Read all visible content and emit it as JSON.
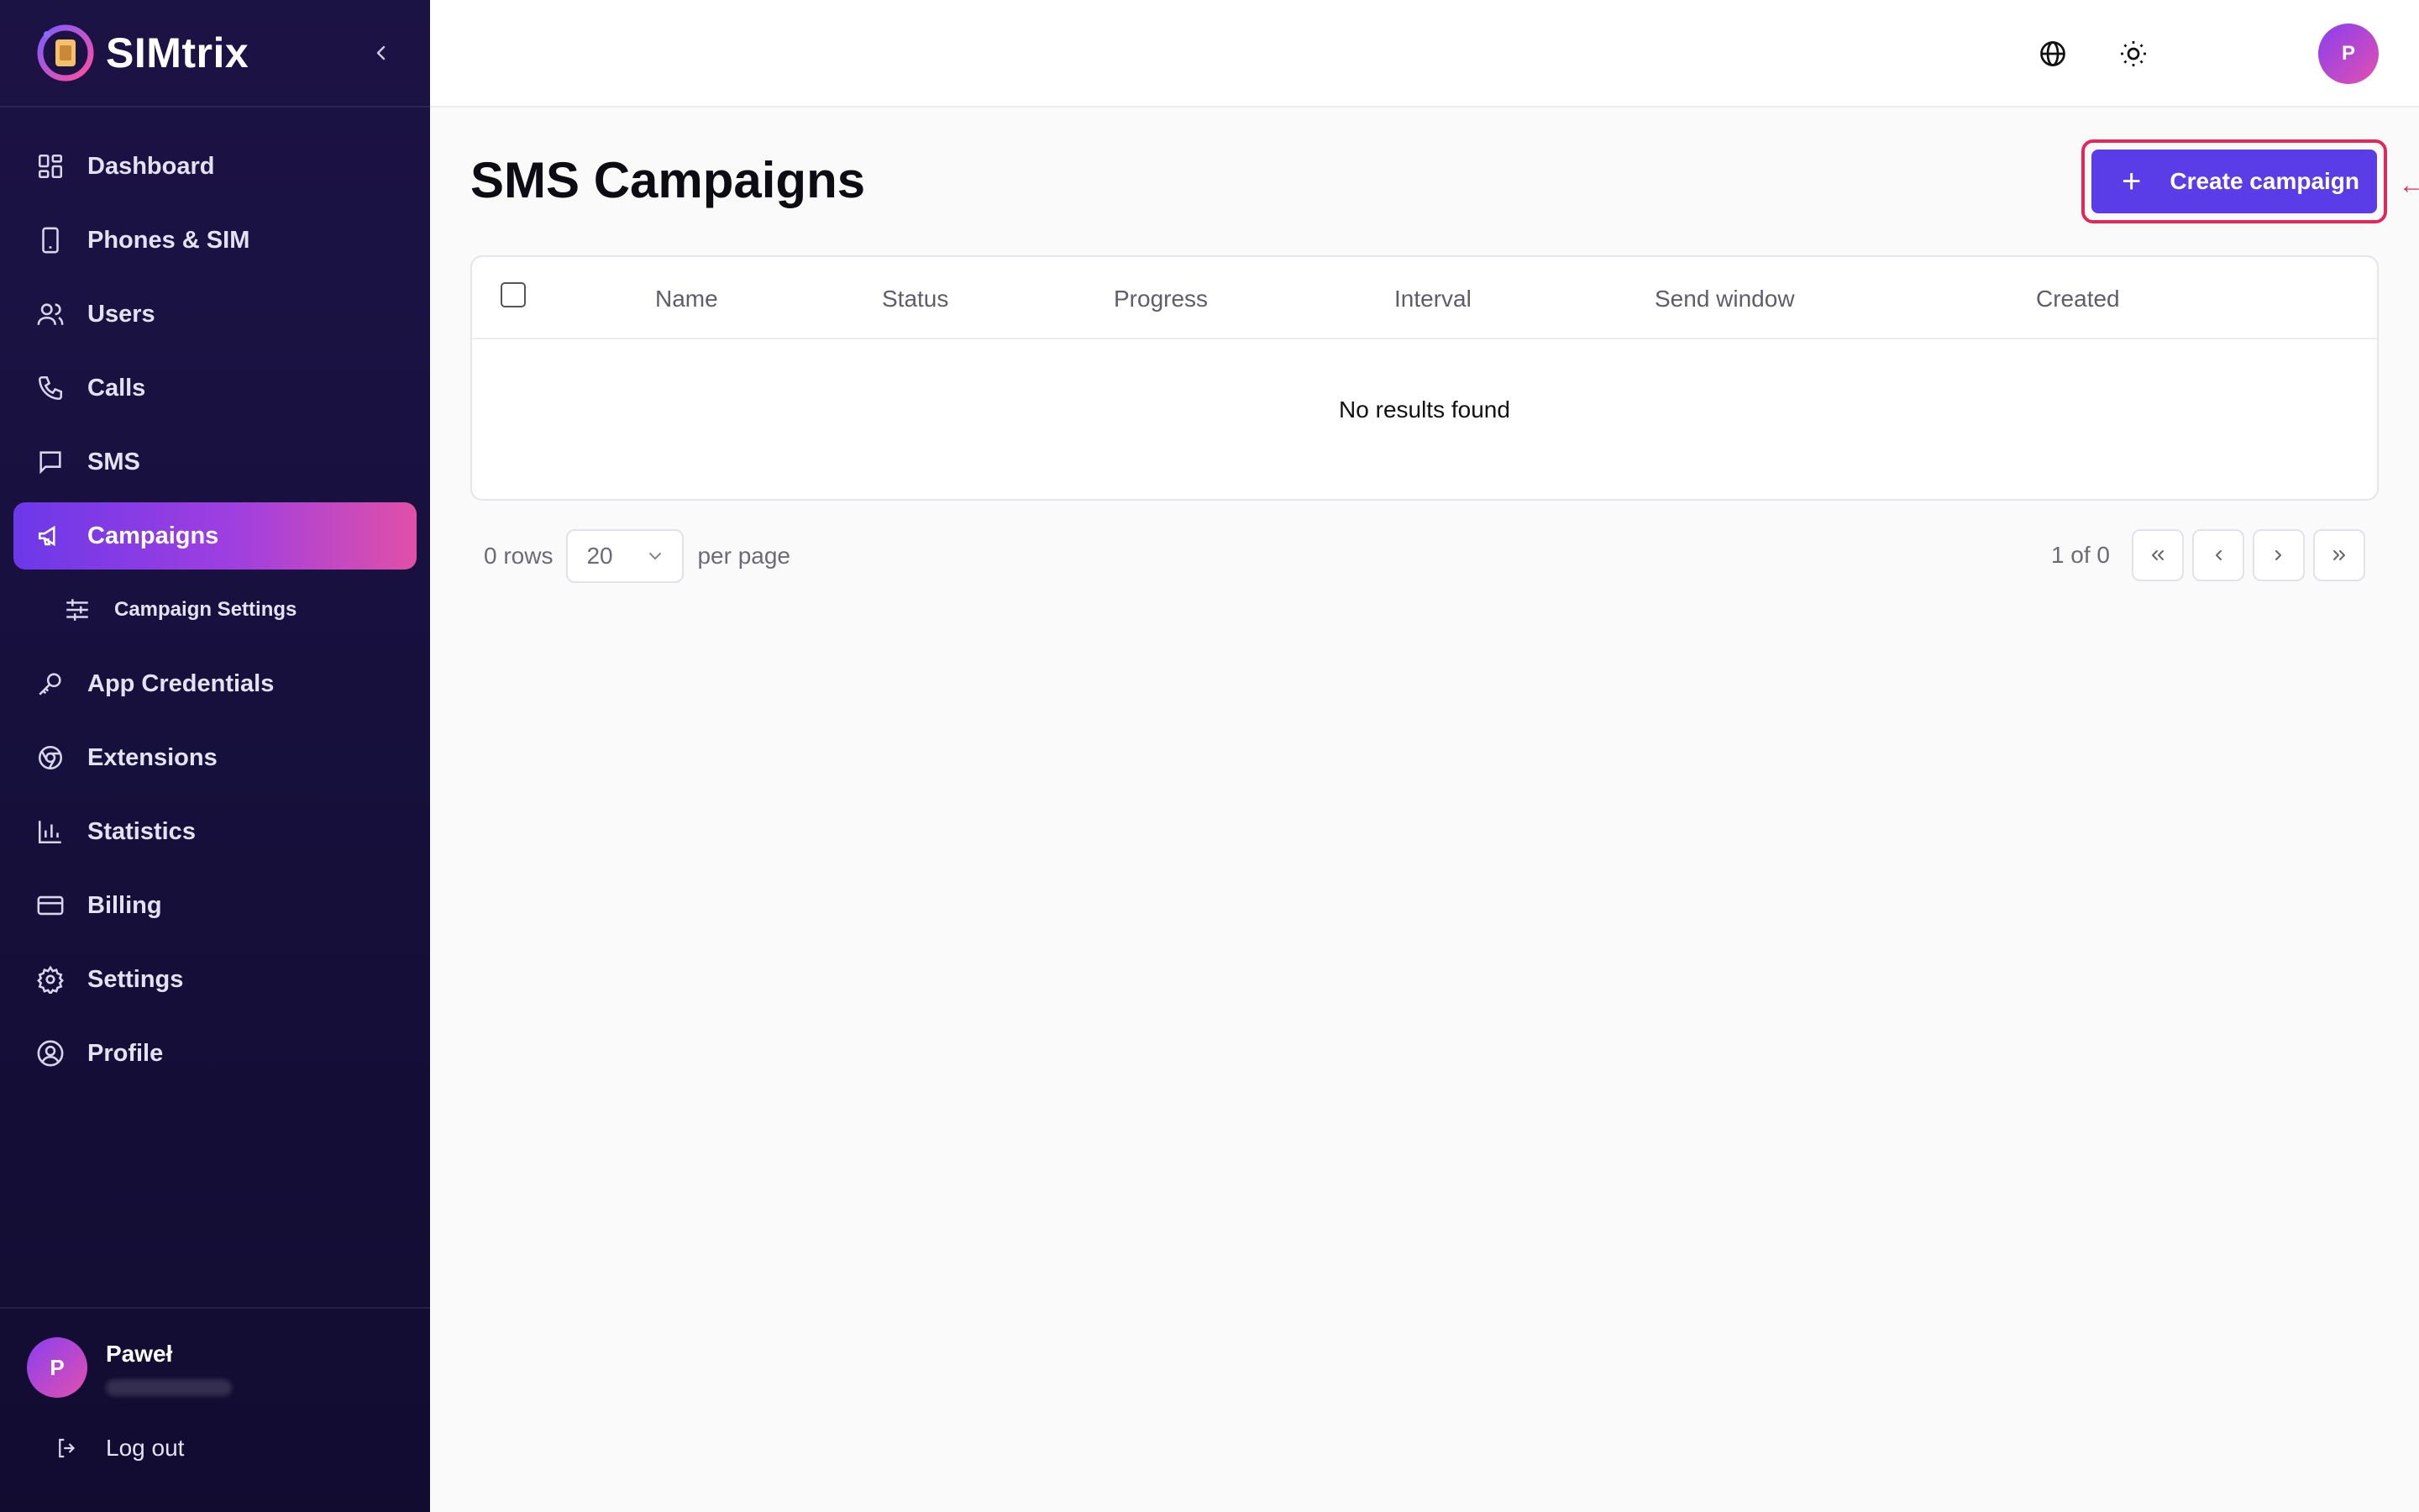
{
  "app": {
    "name": "SIMtrix"
  },
  "sidebar": {
    "items": [
      {
        "label": "Dashboard",
        "icon": "dashboard-icon"
      },
      {
        "label": "Phones & SIM",
        "icon": "phone-device-icon"
      },
      {
        "label": "Users",
        "icon": "users-icon"
      },
      {
        "label": "Calls",
        "icon": "phone-call-icon"
      },
      {
        "label": "SMS",
        "icon": "message-icon"
      },
      {
        "label": "Campaigns",
        "icon": "megaphone-icon",
        "active": true
      },
      {
        "label": "Campaign Settings",
        "icon": "sliders-icon",
        "sub": true
      },
      {
        "label": "App Credentials",
        "icon": "key-icon"
      },
      {
        "label": "Extensions",
        "icon": "chrome-icon"
      },
      {
        "label": "Statistics",
        "icon": "bar-chart-icon"
      },
      {
        "label": "Billing",
        "icon": "credit-card-icon"
      },
      {
        "label": "Settings",
        "icon": "gear-icon"
      },
      {
        "label": "Profile",
        "icon": "user-circle-icon"
      }
    ],
    "user": {
      "initial": "P",
      "name": "Paweł"
    },
    "logout_label": "Log out"
  },
  "topbar": {
    "avatar_initial": "P"
  },
  "page": {
    "title": "SMS Campaigns",
    "create_label": "Create campaign"
  },
  "table": {
    "columns": [
      "Name",
      "Status",
      "Progress",
      "Interval",
      "Send window",
      "Created"
    ],
    "empty_message": "No results found"
  },
  "pagination": {
    "rows_label": "0 rows",
    "per_page_value": "20",
    "per_page_label": "per page",
    "page_info": "1 of 0"
  },
  "colors": {
    "sidebar_bg": "#1c1345",
    "accent": "#5b3de8",
    "active_gradient_start": "#6c38e8",
    "active_gradient_end": "#e050a8",
    "highlight": "#e0285a"
  }
}
